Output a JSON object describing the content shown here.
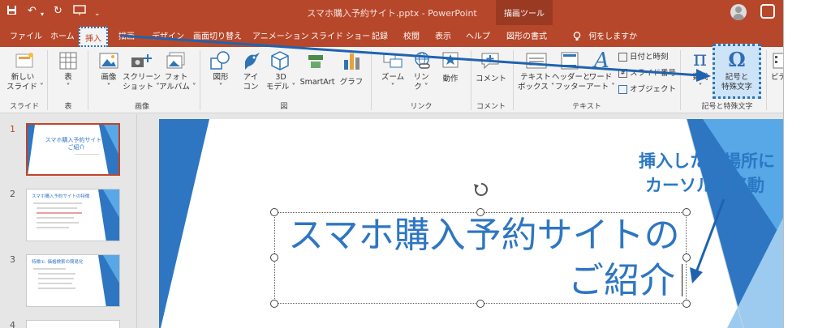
{
  "titlebar": {
    "title": "スマホ購入予約サイト.pptx  -  PowerPoint",
    "context_tab": "描画ツール"
  },
  "tabs": [
    "ファイル",
    "ホーム",
    "挿入",
    "描画",
    "デザイン",
    "画面切り替え",
    "アニメーション",
    "スライド ショー",
    "記録",
    "校閲",
    "表示",
    "ヘルプ",
    "図形の書式"
  ],
  "tell_me": "何をしますか",
  "ribbon": {
    "new_slide": [
      "新しい",
      "スライド ˅"
    ],
    "table": [
      "表",
      "˅"
    ],
    "image": [
      "画像",
      "˅"
    ],
    "screenshot": [
      "スクリーン",
      "ショット ˅"
    ],
    "photo_album": [
      "フォト",
      "アルバム ˅"
    ],
    "shapes": [
      "図形",
      "˅"
    ],
    "icons": [
      "アイ",
      "コン"
    ],
    "model3d": [
      "3D",
      "モデル ˅"
    ],
    "smartart": "SmartArt",
    "graph": "グラフ",
    "zoom": [
      "ズーム",
      "˅"
    ],
    "link": [
      "リン",
      "ク ˅"
    ],
    "action": "動作",
    "comment": "コメント",
    "textbox": [
      "テキスト",
      "ボックス ˅"
    ],
    "header_footer": [
      "ヘッダーと",
      "フッター"
    ],
    "wordart": [
      "ワード",
      "アート ˅"
    ],
    "date_time": "日付と時刻",
    "slide_number": "スライド番号",
    "object": "オブジェクト",
    "equation": [
      "数式",
      "˅"
    ],
    "symbol": [
      "記号と",
      "特殊文字"
    ],
    "video": "ビデ"
  },
  "groups": [
    "スライド",
    "表",
    "画像",
    "図",
    "リンク",
    "コメント",
    "テキスト",
    "記号と特殊文字"
  ],
  "thumbnails": {
    "numbers": [
      "1",
      "2",
      "3",
      "4"
    ],
    "t1_title": "スマホ購入予約サイトの\nご紹介",
    "t2_title": "スマホ購入予約サイトの特徴",
    "t3_title": "特徴①: 価格検索の簡易化"
  },
  "slide": {
    "title_line1": "スマホ購入予約サイトの",
    "title_line2": "ご紹介"
  },
  "annotation": [
    "挿入したい場所に",
    "カーソルを移動"
  ]
}
